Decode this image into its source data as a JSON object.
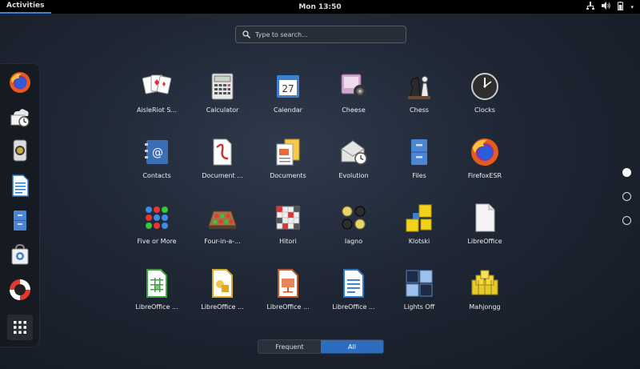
{
  "topbar": {
    "activities": "Activities",
    "clock": "Mon 13:50"
  },
  "tray": {
    "network_icon": "network-icon",
    "volume_icon": "volume-icon",
    "battery_icon": "battery-icon",
    "menu_arrow": "▾"
  },
  "search": {
    "placeholder": "Type to search..."
  },
  "dash": {
    "items": [
      {
        "name": "firefox-icon"
      },
      {
        "name": "software-icon"
      },
      {
        "name": "evolution-icon"
      },
      {
        "name": "libreoffice-writer-icon"
      },
      {
        "name": "files-icon"
      },
      {
        "name": "software-center-icon"
      },
      {
        "name": "help-icon"
      },
      {
        "name": "show-apps-icon"
      }
    ]
  },
  "apps": [
    {
      "label": "AisleRiot S...",
      "icon": "cards-icon"
    },
    {
      "label": "Calculator",
      "icon": "calculator-icon"
    },
    {
      "label": "Calendar",
      "icon": "calendar-icon",
      "day": "27"
    },
    {
      "label": "Cheese",
      "icon": "cheese-icon"
    },
    {
      "label": "Chess",
      "icon": "chess-icon"
    },
    {
      "label": "Clocks",
      "icon": "clock-icon"
    },
    {
      "label": "Contacts",
      "icon": "contacts-icon"
    },
    {
      "label": "Document ...",
      "icon": "document-viewer-icon"
    },
    {
      "label": "Documents",
      "icon": "documents-icon"
    },
    {
      "label": "Evolution",
      "icon": "evolution-icon"
    },
    {
      "label": "Files",
      "icon": "files-icon"
    },
    {
      "label": "FirefoxESR",
      "icon": "firefox-icon"
    },
    {
      "label": "Five or More",
      "icon": "five-or-more-icon"
    },
    {
      "label": "Four-in-a-...",
      "icon": "four-in-a-row-icon"
    },
    {
      "label": "Hitori",
      "icon": "hitori-icon"
    },
    {
      "label": "Iagno",
      "icon": "iagno-icon"
    },
    {
      "label": "Klotski",
      "icon": "klotski-icon"
    },
    {
      "label": "LibreOffice",
      "icon": "libreoffice-icon"
    },
    {
      "label": "LibreOffice ...",
      "icon": "libreoffice-calc-icon"
    },
    {
      "label": "LibreOffice ...",
      "icon": "libreoffice-draw-icon"
    },
    {
      "label": "LibreOffice ...",
      "icon": "libreoffice-impress-icon"
    },
    {
      "label": "LibreOffice ...",
      "icon": "libreoffice-writer-icon"
    },
    {
      "label": "Lights Off",
      "icon": "lights-off-icon"
    },
    {
      "label": "Mahjongg",
      "icon": "mahjongg-icon"
    }
  ],
  "pager": {
    "pages": 3,
    "active": 0
  },
  "switcher": {
    "frequent": "Frequent",
    "all": "All",
    "active": "all"
  },
  "colors": {
    "accent": "#2d6dbf",
    "topbar": "#000000",
    "background": "#1f2735"
  }
}
